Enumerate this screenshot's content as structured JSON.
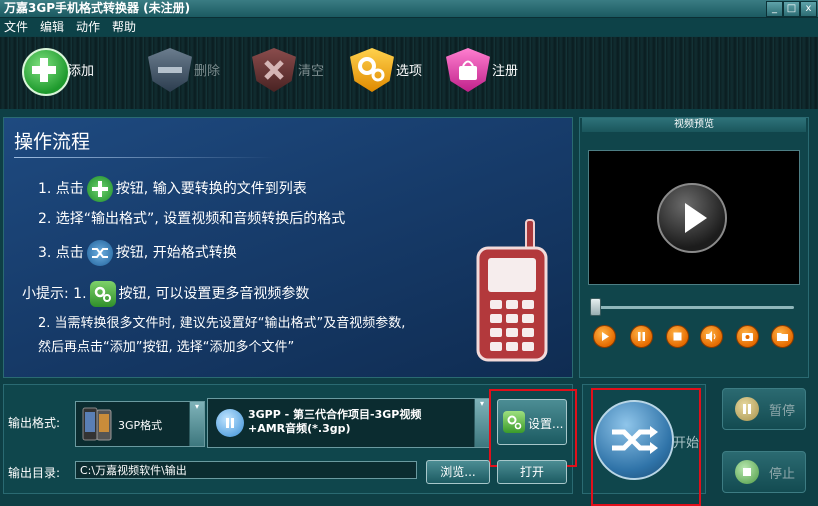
{
  "window": {
    "title": "万嘉3GP手机格式转换器  (未注册)",
    "min": "_",
    "max": "□",
    "close": "x"
  },
  "menu": [
    "文件",
    "编辑",
    "动作",
    "帮助"
  ],
  "toolbar": {
    "add": "添加",
    "delete": "删除",
    "clear": "清空",
    "options": "选项",
    "register": "注册"
  },
  "workflow": {
    "title": "操作流程",
    "step1_prefix": "1. 点击",
    "step1_suffix": "按钮, 输入要转换的文件到列表",
    "step2": "2. 选择“输出格式”, 设置视频和音频转换后的格式",
    "step3_prefix": "3. 点击",
    "step3_suffix": "按钮, 开始格式转换",
    "tip_prefix": "小提示: 1.",
    "tip_suffix": "按钮, 可以设置更多音视频参数",
    "tip2_line1": "2. 当需转换很多文件时, 建议先设置好“输出格式”及音视频参数,",
    "tip2_line2": "然后再点击“添加”按钮, 选择“添加多个文件”"
  },
  "preview": {
    "title": "视频预览"
  },
  "output": {
    "format_label": "输出格式:",
    "format_value": "3GP格式",
    "profile_line1": "3GPP  -  第三代合作项目-3GP视频",
    "profile_line2": "+AMR音频(*.3gp)",
    "settings_button": "设置...",
    "dir_label": "输出目录:",
    "dir_value": "C:\\万嘉视频软件\\输出",
    "browse_button": "浏览...",
    "open_button": "打开"
  },
  "actions": {
    "start": "开始",
    "pause": "暂停",
    "stop": "停止"
  },
  "colors": {
    "accent_red": "#e0101b",
    "panel_teal": "#0f464c",
    "workflow_blue": "#173c6b"
  }
}
